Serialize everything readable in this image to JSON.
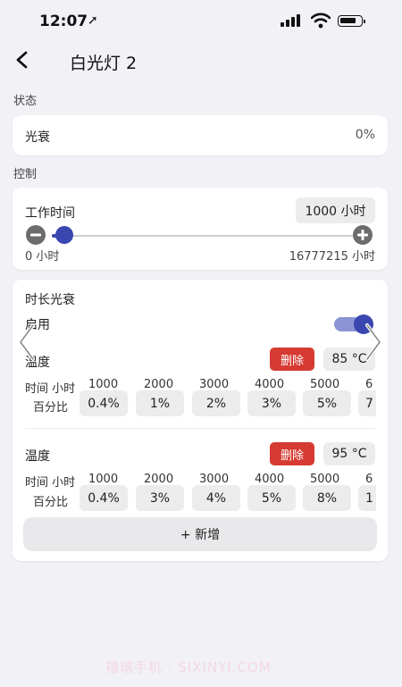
{
  "status_bar": {
    "time": "12:07",
    "arrow": "➚"
  },
  "nav": {
    "title": "白光灯 2"
  },
  "status_section": {
    "label": "状态",
    "light_decay": {
      "label": "光衰",
      "value": "0%"
    }
  },
  "control_section": {
    "label": "控制",
    "work_time": {
      "label": "工作时间",
      "value": "1000 小时",
      "min_label": "0 小时",
      "max_label": "16777215 小时",
      "slider_fraction": 0.2
    }
  },
  "decay_card": {
    "title": "时长光衰",
    "enable_label": "启用",
    "enabled": true,
    "blocks": [
      {
        "temp_label": "温度",
        "delete_label": "删除",
        "temp_value": "85 °C",
        "time_label": "时间 小时",
        "percent_label": "百分比",
        "times": [
          "1000",
          "2000",
          "3000",
          "4000",
          "5000",
          "6"
        ],
        "percents": [
          "0.4%",
          "1%",
          "2%",
          "3%",
          "5%",
          "7"
        ]
      },
      {
        "temp_label": "温度",
        "delete_label": "删除",
        "temp_value": "95 °C",
        "time_label": "时间 小时",
        "percent_label": "百分比",
        "times": [
          "1000",
          "2000",
          "3000",
          "4000",
          "5000",
          "6"
        ],
        "percents": [
          "0.4%",
          "3%",
          "4%",
          "5%",
          "8%",
          "1"
        ]
      }
    ],
    "add_label": "+ 新增"
  },
  "watermark": "禧瑞手机 · SIXINYI.COM",
  "colors": {
    "accent": "#3b47b0",
    "danger": "#d63b33",
    "background": "#f1f1f6"
  }
}
